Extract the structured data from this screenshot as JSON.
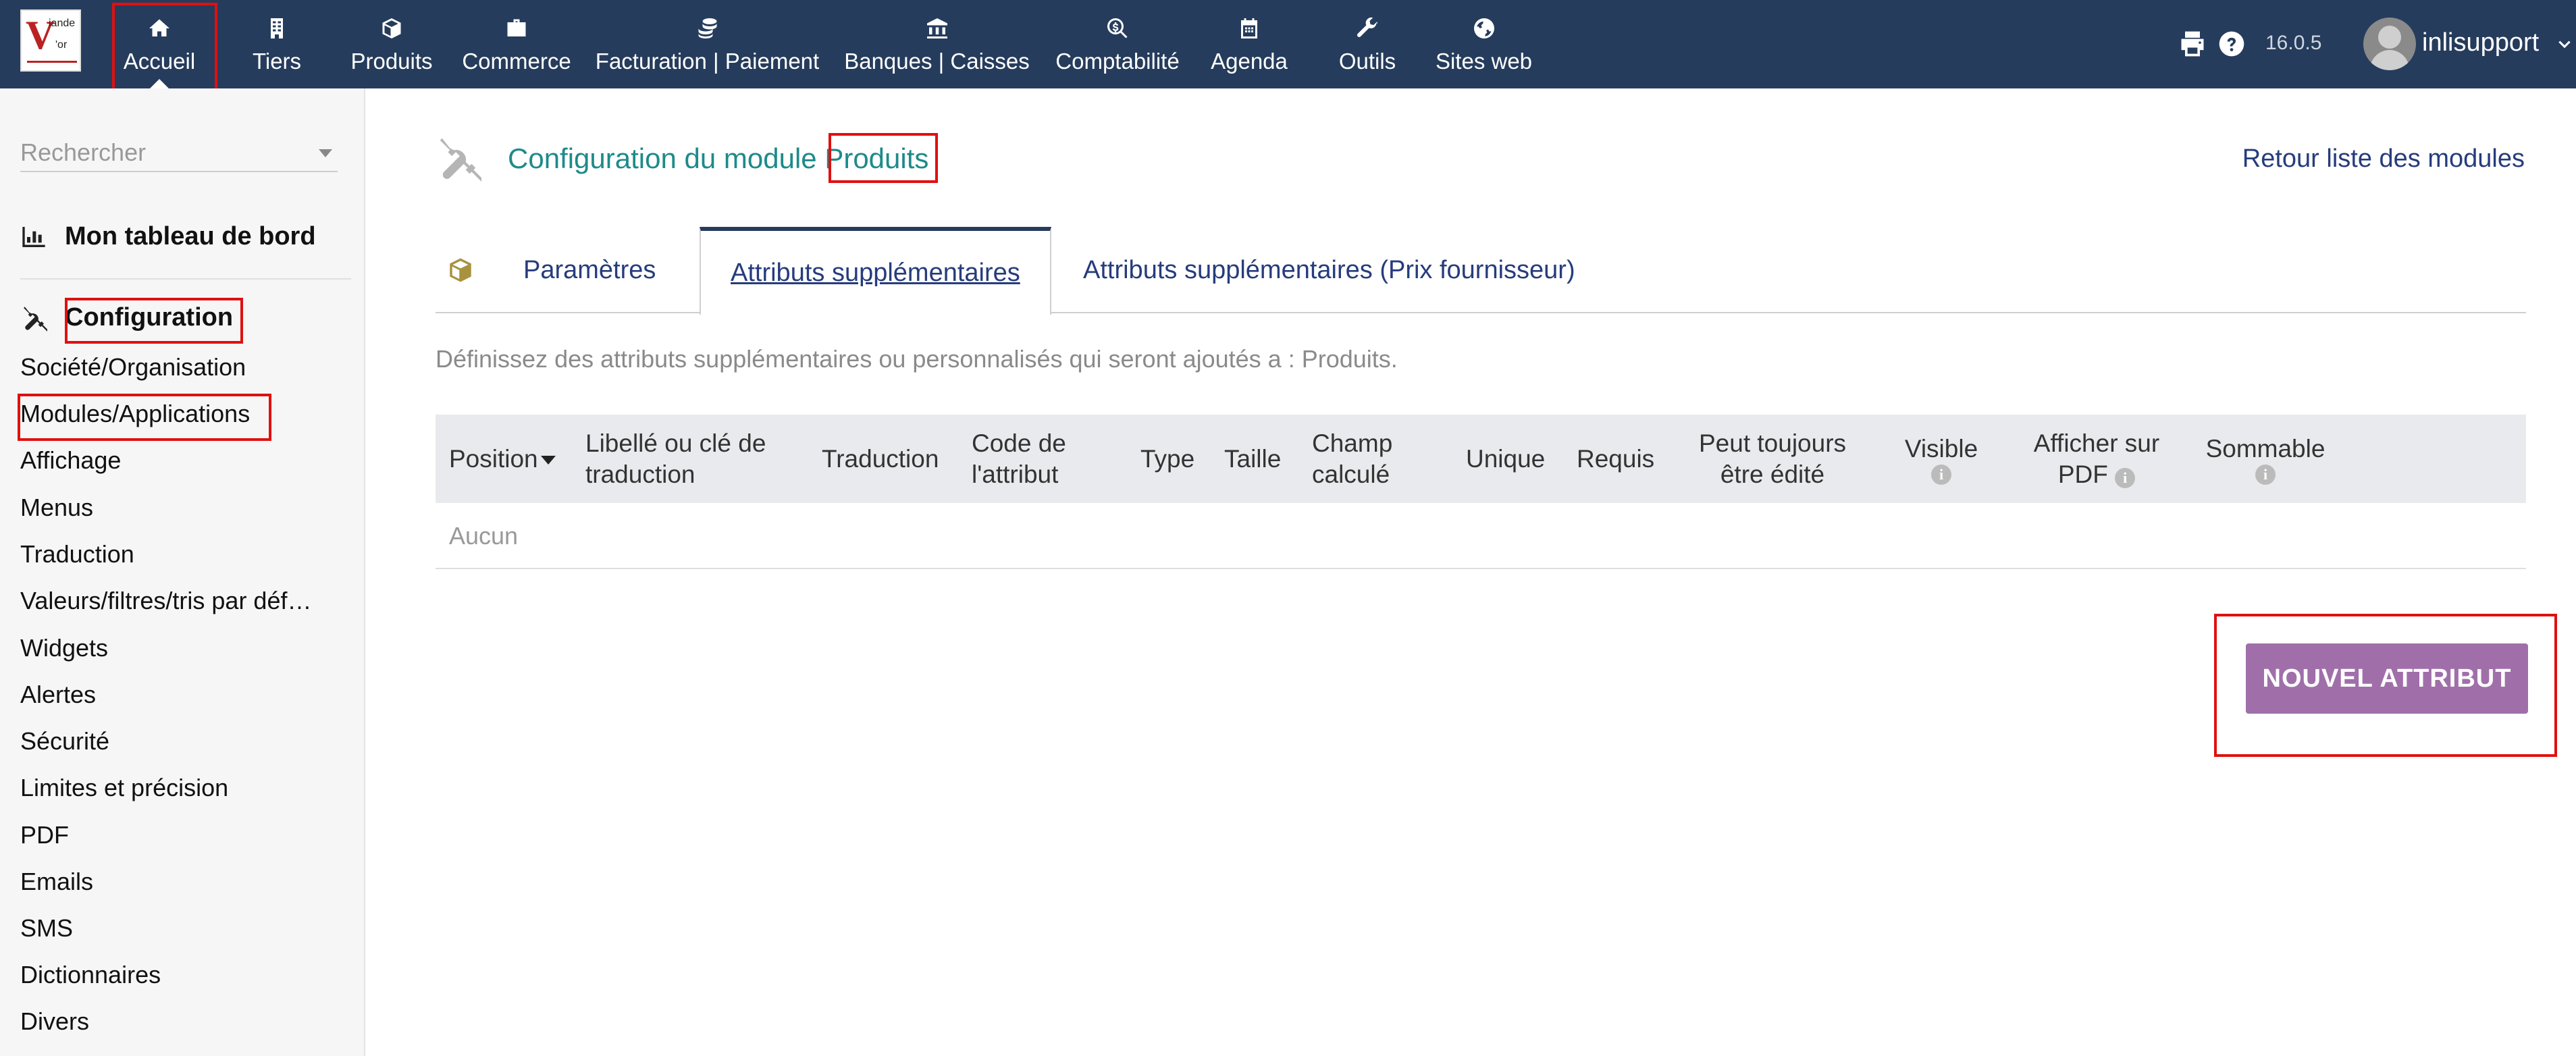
{
  "topbar": {
    "logo": {
      "v": "V",
      "line1": "iande",
      "line2": "'or"
    },
    "nav": [
      {
        "label": "Accueil",
        "icon": "home-icon"
      },
      {
        "label": "Tiers",
        "icon": "building-icon"
      },
      {
        "label": "Produits",
        "icon": "cube-icon"
      },
      {
        "label": "Commerce",
        "icon": "briefcase-icon"
      },
      {
        "label": "Facturation | Paiement",
        "icon": "coins-icon"
      },
      {
        "label": "Banques | Caisses",
        "icon": "bank-icon"
      },
      {
        "label": "Comptabilité",
        "icon": "search-dollar-icon"
      },
      {
        "label": "Agenda",
        "icon": "calendar-icon"
      },
      {
        "label": "Outils",
        "icon": "wrench-icon"
      },
      {
        "label": "Sites web",
        "icon": "globe-icon"
      }
    ],
    "version": "16.0.5",
    "username": "inlisupport"
  },
  "sidebar": {
    "search_placeholder": "Rechercher",
    "dashboard": "Mon tableau de bord",
    "config_head": "Configuration",
    "items": [
      "Société/Organisation",
      "Modules/Applications",
      "Affichage",
      "Menus",
      "Traduction",
      "Valeurs/filtres/tris par déf…",
      "Widgets",
      "Alertes",
      "Sécurité",
      "Limites et précision",
      "PDF",
      "Emails",
      "SMS",
      "Dictionnaires",
      "Divers"
    ]
  },
  "main": {
    "title_prefix": "Configuration du module ",
    "title_module": "Produits",
    "return_link": "Retour liste des modules",
    "tabs": [
      "Paramètres",
      "Attributs supplémentaires",
      "Attributs supplémentaires (Prix fournisseur)"
    ],
    "description": "Définissez des attributs supplémentaires ou personnalisés qui seront ajoutés a : Produits.",
    "table": {
      "headers": {
        "position": "Position",
        "label_1": "Libellé ou clé de",
        "label_2": "traduction",
        "translation": "Traduction",
        "code_1": "Code de",
        "code_2": "l'attribut",
        "type": "Type",
        "size": "Taille",
        "computed_1": "Champ",
        "computed_2": "calculé",
        "unique": "Unique",
        "required": "Requis",
        "editable_1": "Peut toujours",
        "editable_2": "être édité",
        "visible": "Visible",
        "pdf_1": "Afficher sur",
        "pdf_2": "PDF",
        "summable": "Sommable"
      },
      "empty": "Aucun"
    },
    "new_button": "NOUVEL ATTRIBUT"
  },
  "colors": {
    "topbar": "#263c5c",
    "accent_title": "#1e8a8a",
    "link": "#263c7c",
    "button": "#a06faa",
    "highlight_box": "#e01010"
  }
}
